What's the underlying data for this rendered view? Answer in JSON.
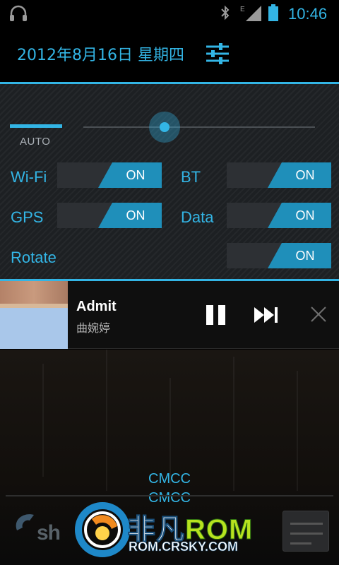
{
  "status_bar": {
    "time": "10:46",
    "network_type": "E",
    "icons": [
      "headphones-icon",
      "bluetooth-icon",
      "signal-icon",
      "battery-icon"
    ]
  },
  "header": {
    "date": "2012年8月16日 星期四",
    "settings_icon": "settings-sliders-icon"
  },
  "quick_settings": {
    "brightness": {
      "auto_label": "AUTO",
      "level": 0.35
    },
    "toggles": [
      {
        "label": "Wi-Fi",
        "state": "ON"
      },
      {
        "label": "BT",
        "state": "ON"
      },
      {
        "label": "GPS",
        "state": "ON"
      },
      {
        "label": "Data",
        "state": "ON"
      },
      {
        "label": "Rotate",
        "state": "ON"
      }
    ]
  },
  "music": {
    "title": "Admit",
    "artist": "曲婉婷",
    "controls": [
      "pause-icon",
      "next-track-icon",
      "close-icon"
    ]
  },
  "lockscreen": {
    "carriers": [
      "CMCC",
      "CMCC"
    ],
    "partial_text": "sh"
  },
  "watermark": {
    "brand_cn": "非凡",
    "brand_en": "ROM",
    "url": "ROM.CRSKY.COM"
  },
  "colors": {
    "accent": "#33b5e5",
    "toggle_on": "#1f8fba",
    "panel_bg": "#1d2023",
    "brand_green": "#b7e21f"
  }
}
